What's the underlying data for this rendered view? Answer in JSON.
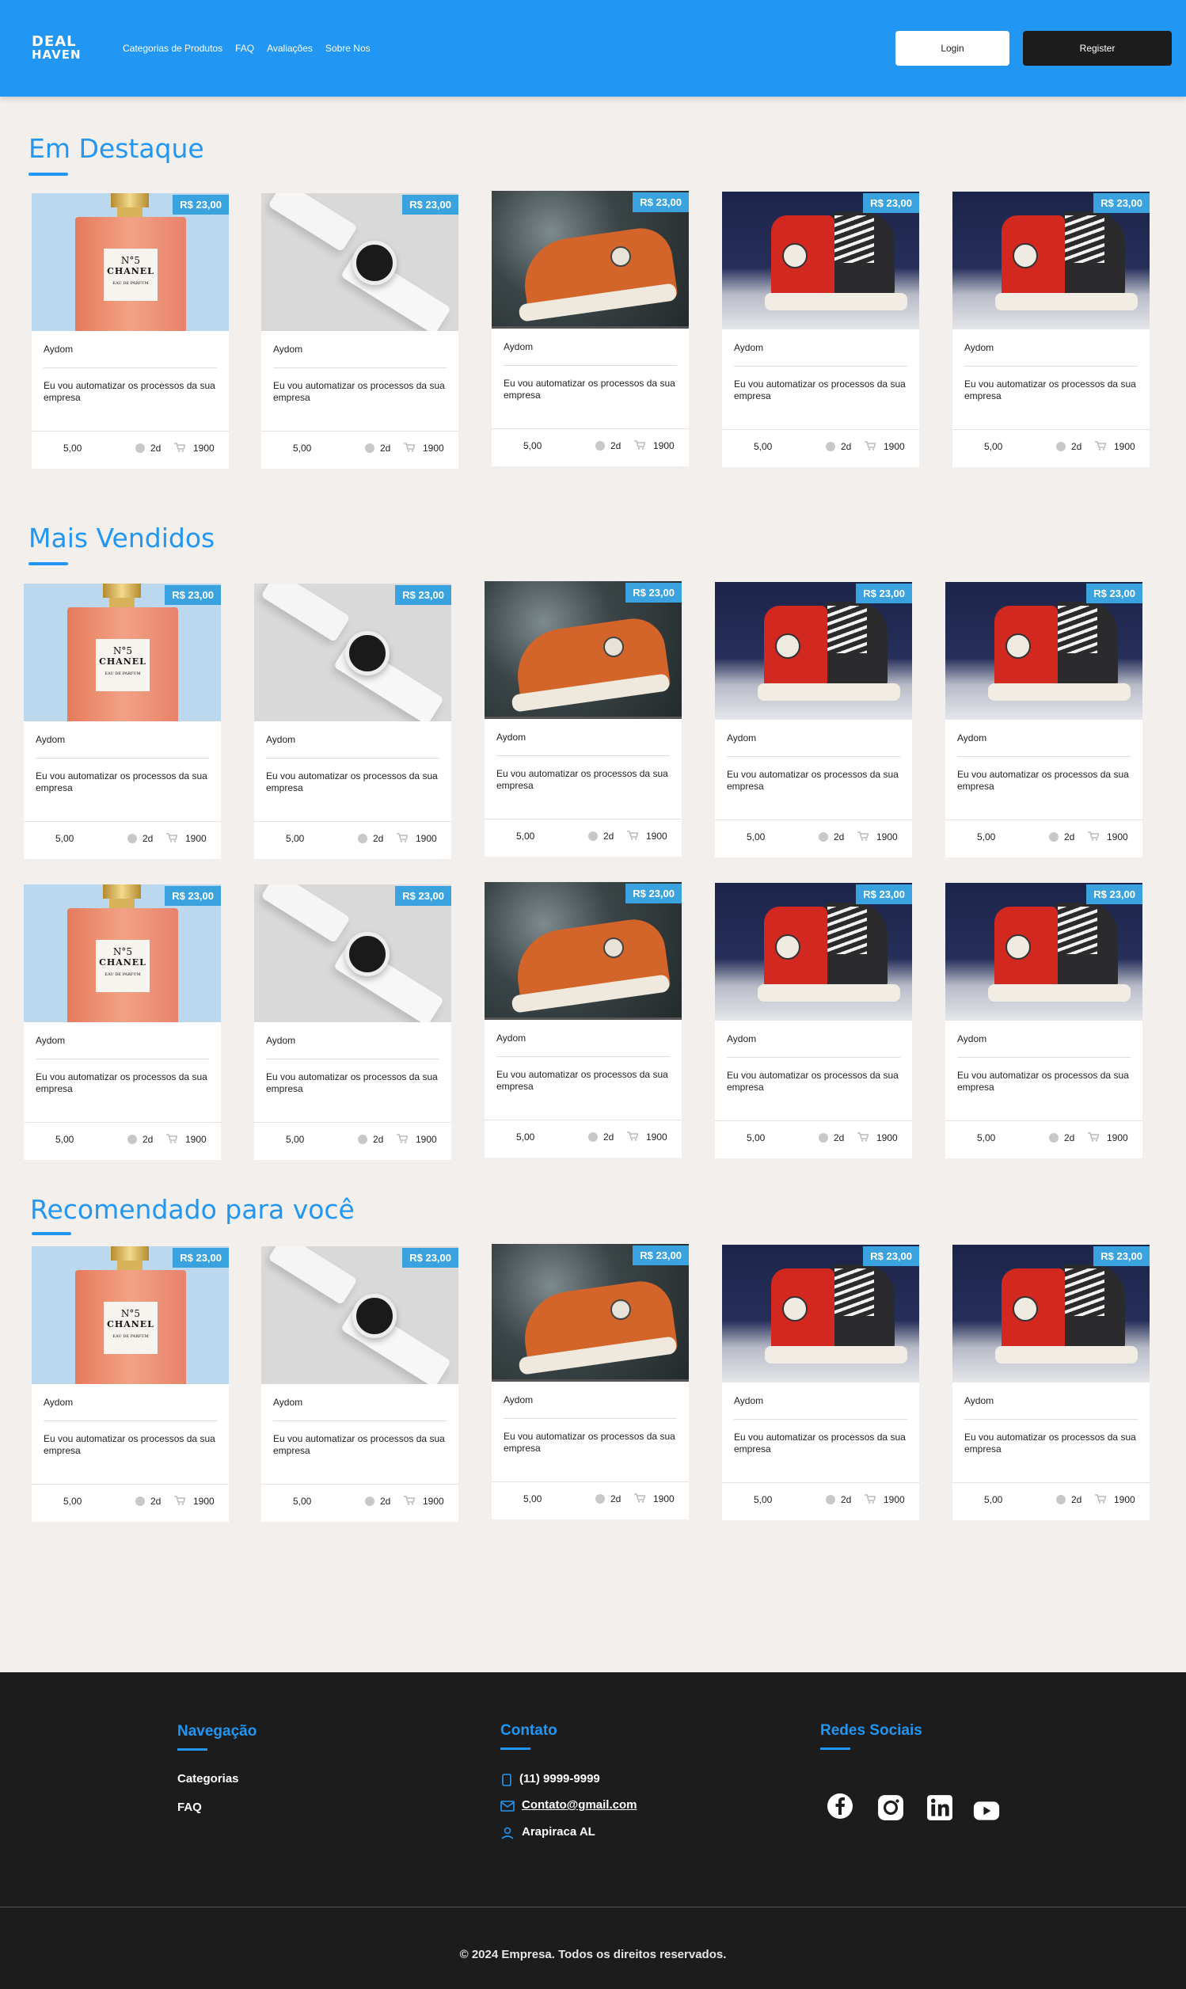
{
  "header": {
    "logo_line1": "DEAL",
    "logo_line2": "HAVEN",
    "nav": [
      "Categorias de Produtos",
      "FAQ",
      "Avaliações",
      "Sobre Nos"
    ],
    "login_label": "Login",
    "register_label": "Register"
  },
  "sections": [
    {
      "title": "Em Destaque"
    },
    {
      "title": "Mais Vendidos"
    },
    {
      "title": "Recomendado para você"
    }
  ],
  "product": {
    "price": "R$ 23,00",
    "seller": "Aydom",
    "description": "Eu vou automatizar os processos da sua empresa",
    "rating": "5,00",
    "days": "2d",
    "sales": "1900"
  },
  "product_images": [
    "chanel-perfume",
    "white-smartwatch",
    "orange-sneaker",
    "red-black-sneaker",
    "red-black-sneaker"
  ],
  "perfume_label": {
    "n5": "N°5",
    "brand": "CHANEL",
    "sub": "EAU DE PARFUM"
  },
  "footer": {
    "nav_title": "Navegação",
    "nav_links": [
      "Categorias",
      "FAQ"
    ],
    "contact_title": "Contato",
    "phone": "(11) 9999-9999",
    "email": "Contato@gmail.com",
    "location": "Arapiraca AL",
    "social_title": "Redes Sociais",
    "social_icons": [
      "facebook-icon",
      "instagram-icon",
      "linkedin-icon",
      "youtube-icon"
    ],
    "copyright": "© 2024 Empresa. Todos os direitos reservados."
  },
  "colors": {
    "accent": "#2196f3",
    "price_badge": "#3aa3df",
    "footer_bg": "#1c1c1c",
    "page_bg": "#f3efed"
  }
}
